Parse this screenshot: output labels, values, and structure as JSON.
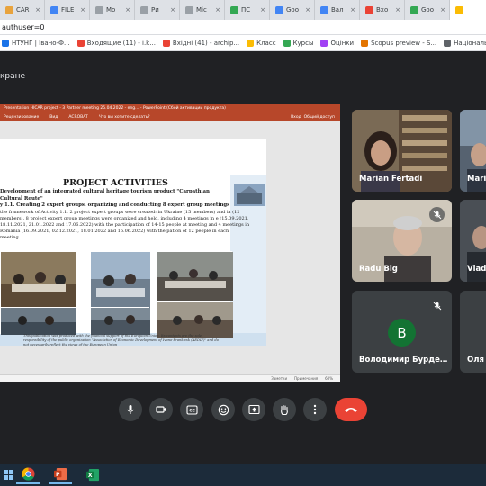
{
  "browser": {
    "tabs": [
      {
        "label": "CAR",
        "color": "#e8a33d"
      },
      {
        "label": "FILE",
        "color": "#4285f4"
      },
      {
        "label": "Mo",
        "color": "#9aa0a6"
      },
      {
        "label": "Ри",
        "color": "#9aa0a6"
      },
      {
        "label": "Mic",
        "color": "#9aa0a6"
      },
      {
        "label": "ПС",
        "color": "#34a853"
      },
      {
        "label": "Goo",
        "color": "#4285f4"
      },
      {
        "label": "Вал",
        "color": "#4285f4"
      },
      {
        "label": "Вхо",
        "color": "#ea4335"
      },
      {
        "label": "Goo",
        "color": "#34a853"
      },
      {
        "label": "",
        "color": "#fbbc04"
      }
    ],
    "url": "authuser=0",
    "bookmarks": [
      {
        "label": "НТУНГ | Івано-Ф...",
        "color": "#1a73e8"
      },
      {
        "label": "Входящие (11) - i.k...",
        "color": "#ea4335"
      },
      {
        "label": "Вхідні (41) - archip...",
        "color": "#ea4335"
      },
      {
        "label": "Класс",
        "color": "#fbbc04"
      },
      {
        "label": "Курсы",
        "color": "#34a853"
      },
      {
        "label": "Оцінки",
        "color": "#a142f4"
      },
      {
        "label": "Scopus preview - S...",
        "color": "#e37400"
      },
      {
        "label": "Національне аг",
        "color": "#5f6368"
      }
    ]
  },
  "meet": {
    "presenting_label": "кране",
    "participants": [
      {
        "name": "Marian Fertadi",
        "muted": false
      },
      {
        "name": "Mari",
        "muted": false
      },
      {
        "name": "Radu Big",
        "muted": true
      },
      {
        "name": "Vlad",
        "muted": false
      },
      {
        "name": "Володимир Бурде…",
        "muted": true,
        "initial": "В"
      },
      {
        "name": "Оля",
        "muted": false
      }
    ],
    "controls": {
      "mic": "mic-icon",
      "camera": "camera-icon",
      "captions": "captions-icon",
      "emoji": "emoji-icon",
      "present": "present-icon",
      "hand": "raise-hand-icon",
      "more": "more-icon",
      "end": "end-call-icon"
    }
  },
  "ppt": {
    "title": "Presentation HICAR project - 3 Partner meeting 25.04.2022 - eng... - PowerPoint (Сбой активации продукта)",
    "ribbon": [
      "Рецензирование",
      "Вид",
      "ACROBAT",
      "Что вы хотите сделать?"
    ],
    "ribbon_right": [
      "Вход",
      "Общий доступ"
    ],
    "status": [
      "Заметки",
      "Примечания",
      "60%"
    ],
    "slide": {
      "title": "PROJECT ACTIVITIES",
      "subtitle_1": "Development of an integrated cultural heritage tourism product \"Carpathian Cultural Route\"",
      "subtitle_2": "y 1.1. Creating 2 expert groups, organizing and conducting 8 expert group meetings",
      "body": "the framework of Activity 1.1. 2 project expert groups were created: in Ukraine (15 members) and ia (12 members). 8 project expert group meetings were organized and held, including 4 meetings in e (15.09.2021, 18.11.2021, 21.01.2022 and 17.06.2022) with the participation of 14-15 people at meeting and 4 meetings in Romania (16.09.2021, 02.12.2021, 18.01.2022 and 16.06.2022) with the pation of 12 people in each meeting.",
      "footer": "This publication was produced with the financial support of the European Union. Its contents are the sole responsibility of the public organization \"Association of Economic Development of Ivano-Frankivsk (AEDIF)\" and do not necessarily reflect the views of the European Union"
    }
  }
}
